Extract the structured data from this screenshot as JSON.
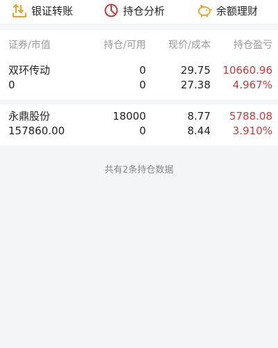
{
  "actions": [
    {
      "label": "银证转账",
      "icon": "transfer-icon"
    },
    {
      "label": "持仓分析",
      "icon": "pie-chart-icon"
    },
    {
      "label": "余额理财",
      "icon": "piggy-bank-icon"
    }
  ],
  "table": {
    "headers": {
      "security": "证券/市值",
      "position": "持仓/可用",
      "price": "现价/成本",
      "profit": "持仓盈亏"
    },
    "rows": [
      {
        "name": "双环传动",
        "market_value": "0",
        "holding": "0",
        "available": "0",
        "current_price": "29.75",
        "cost_price": "27.38",
        "profit_loss": "10660.96",
        "profit_loss_pct": "4.967%"
      },
      {
        "name": "永鼎股份",
        "market_value": "157860.00",
        "holding": "18000",
        "available": "0",
        "current_price": "8.77",
        "cost_price": "8.44",
        "profit_loss": "5788.08",
        "profit_loss_pct": "3.910%"
      }
    ]
  },
  "footer_note": "共有2条持仓数据",
  "colors": {
    "profit": "#d0373a",
    "icon_accent": "#f0a020",
    "icon_red": "#d0373a"
  }
}
